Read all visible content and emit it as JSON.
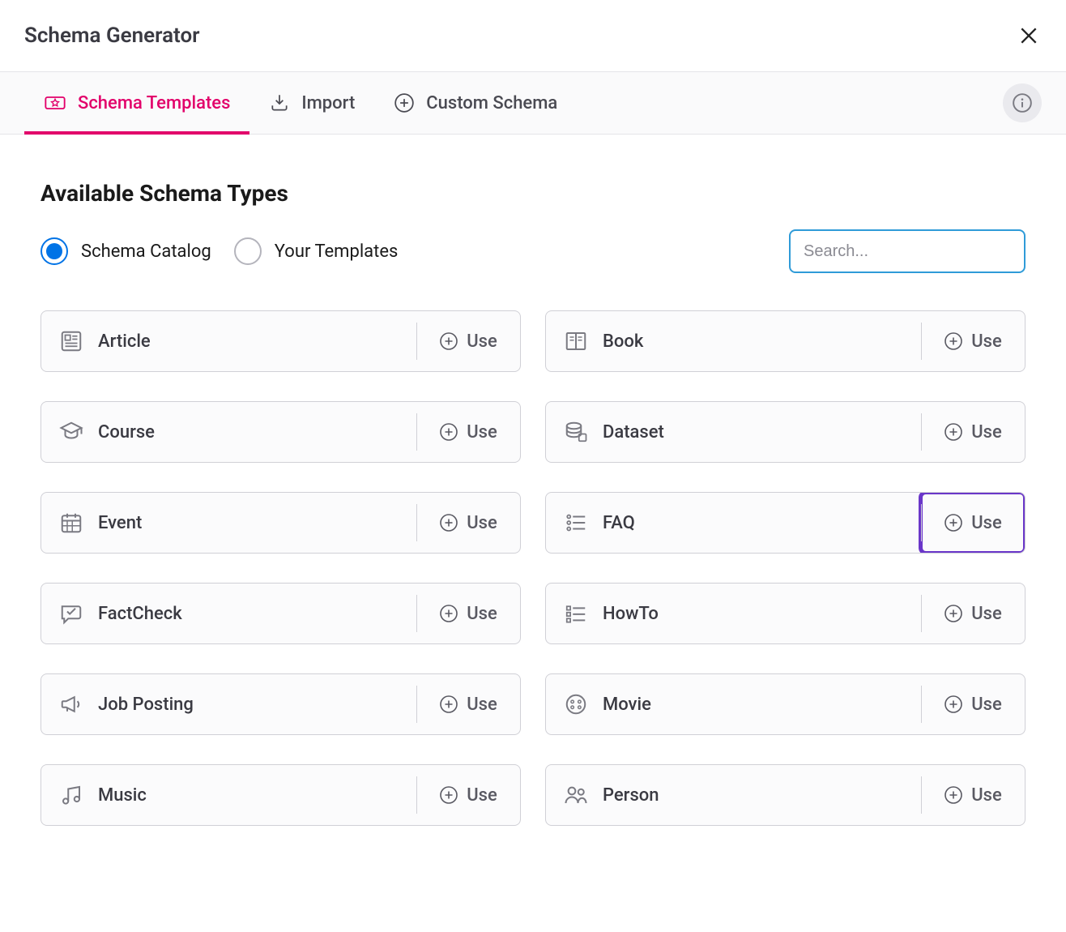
{
  "header": {
    "title": "Schema Generator"
  },
  "tabs": [
    {
      "label": "Schema Templates",
      "active": true
    },
    {
      "label": "Import",
      "active": false
    },
    {
      "label": "Custom Schema",
      "active": false
    }
  ],
  "section_title": "Available Schema Types",
  "radios": [
    {
      "label": "Schema Catalog",
      "checked": true
    },
    {
      "label": "Your Templates",
      "checked": false
    }
  ],
  "search": {
    "placeholder": "Search..."
  },
  "use_label": "Use",
  "schemas": [
    {
      "name": "Article",
      "icon": "article-icon",
      "highlight": false
    },
    {
      "name": "Book",
      "icon": "book-icon",
      "highlight": false
    },
    {
      "name": "Course",
      "icon": "course-icon",
      "highlight": false
    },
    {
      "name": "Dataset",
      "icon": "dataset-icon",
      "highlight": false
    },
    {
      "name": "Event",
      "icon": "calendar-icon",
      "highlight": false
    },
    {
      "name": "FAQ",
      "icon": "faq-icon",
      "highlight": true
    },
    {
      "name": "FactCheck",
      "icon": "factcheck-icon",
      "highlight": false
    },
    {
      "name": "HowTo",
      "icon": "howto-icon",
      "highlight": false
    },
    {
      "name": "Job Posting",
      "icon": "megaphone-icon",
      "highlight": false
    },
    {
      "name": "Movie",
      "icon": "movie-icon",
      "highlight": false
    },
    {
      "name": "Music",
      "icon": "music-icon",
      "highlight": false
    },
    {
      "name": "Person",
      "icon": "person-icon",
      "highlight": false
    }
  ]
}
